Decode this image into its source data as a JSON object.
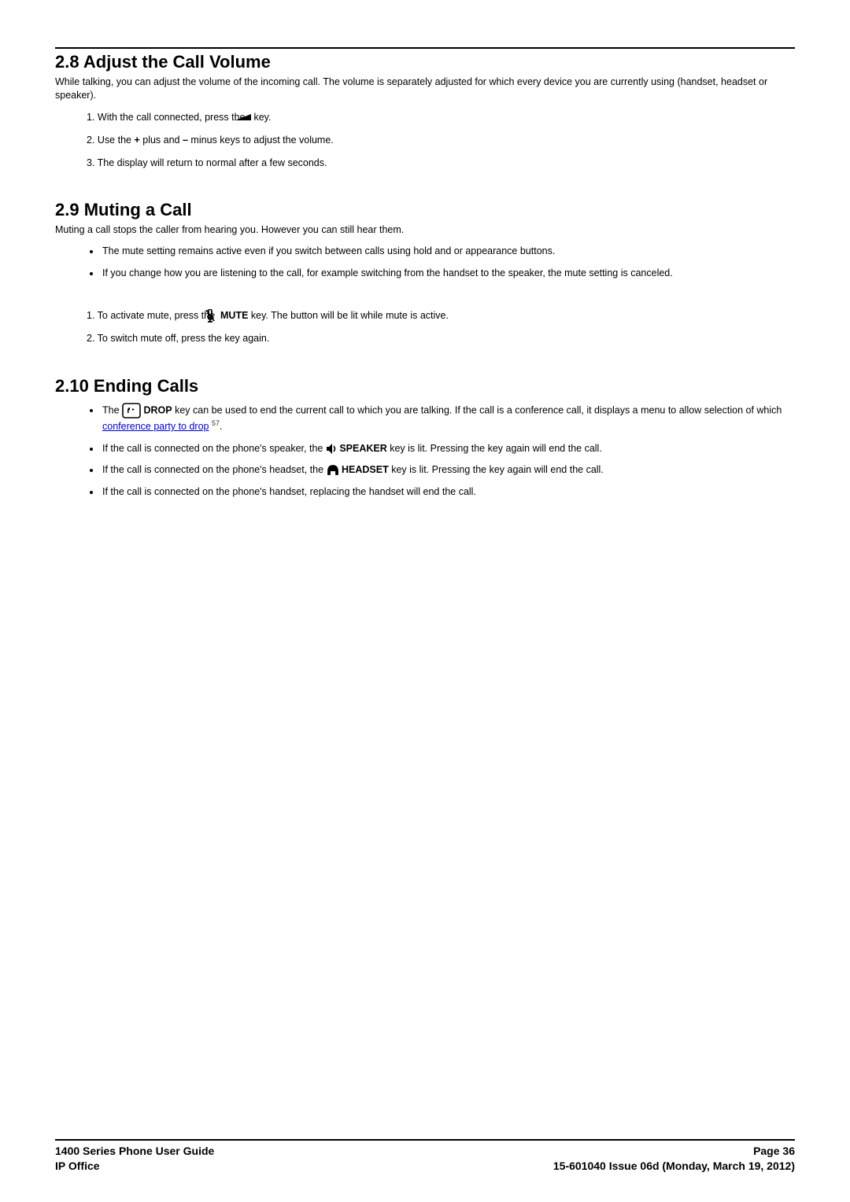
{
  "section28": {
    "heading": "2.8 Adjust the Call Volume",
    "intro": "While talking, you can adjust the volume of the incoming call. The volume is separately adjusted for which every device you are currently using (handset, headset or speaker).",
    "steps": {
      "s1_a": "1. With the call connected, press the ",
      "s1_b": " key.",
      "s2_a": "2. Use the ",
      "plus": "+",
      "s2_b": " plus and ",
      "minus": "–",
      "s2_c": " minus keys to adjust the volume.",
      "s3": "3. The display will return to normal after a few seconds."
    }
  },
  "section29": {
    "heading": "2.9 Muting a Call",
    "intro": "Muting a call stops the caller from hearing you. However you can still hear them.",
    "bullets": {
      "b1": "The mute setting remains active even if you switch between calls using hold and or appearance buttons.",
      "b2": "If you change how you are listening to the call, for example switching from the handset to the speaker, the mute setting is canceled."
    },
    "steps": {
      "s1_a": "1. To activate mute, press the ",
      "mute_label": " MUTE",
      "s1_b": " key. The button will be lit while mute is active.",
      "s2": "2. To switch mute off, press the key again."
    }
  },
  "section210": {
    "heading": "2.10 Ending Calls",
    "bullets": {
      "b1_a": "The ",
      "drop_label": " DROP",
      "b1_b": " key can be used to end the current call to which you are talking. If the call is a conference call, it displays a menu to allow selection of which ",
      "link_text": "conference party to drop",
      "ref": " 57",
      "b1_c": ".",
      "b2_a": "If the call is connected on the phone's speaker, the ",
      "speaker_label": " SPEAKER",
      "b2_b": " key is lit. Pressing the key again will end the call.",
      "b3_a": "If the call is connected on the phone's headset, the ",
      "headset_label": " HEADSET",
      "b3_b": " key is lit. Pressing the key again will end the call.",
      "b4": "If the call is connected on the phone's handset, replacing the handset will end the call."
    }
  },
  "footer": {
    "left1": "1400 Series Phone User Guide",
    "right1": "Page 36",
    "left2": "IP Office",
    "right2": "15-601040 Issue 06d (Monday, March 19, 2012)"
  }
}
